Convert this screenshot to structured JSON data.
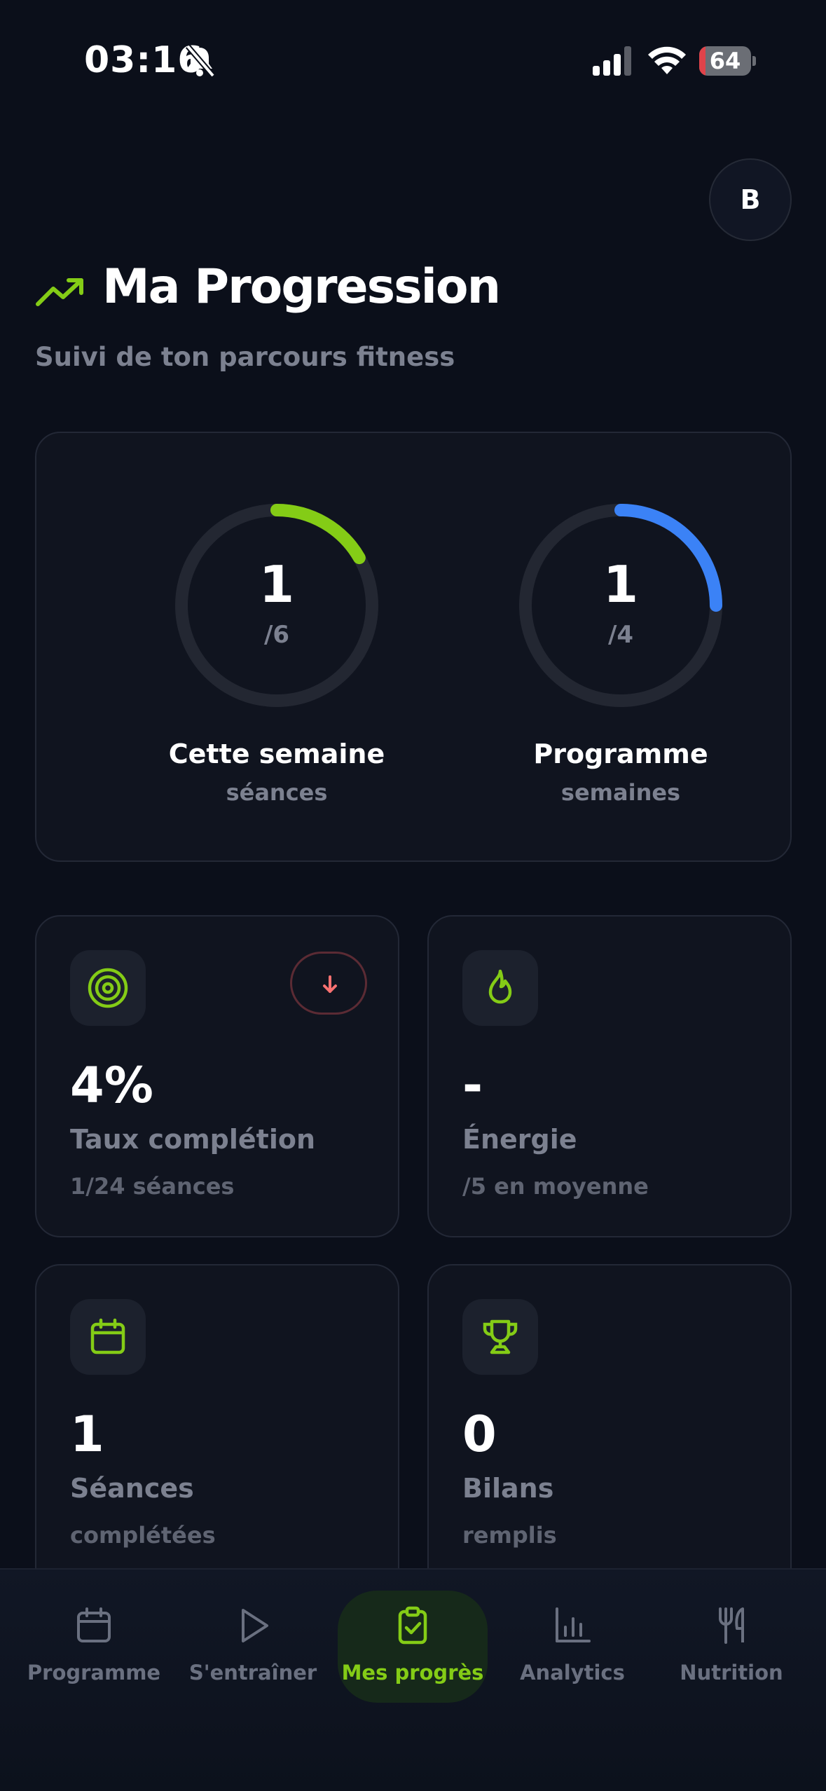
{
  "status_bar": {
    "time": "03:16",
    "battery_level": 64,
    "battery_text": "64",
    "icons": [
      "bell-slash-icon",
      "signal-icon",
      "wifi-icon",
      "battery-charging-icon"
    ]
  },
  "header": {
    "avatar_initial": "B",
    "title": "Ma Progression",
    "subtitle": "Suivi de ton parcours fitness",
    "title_icon": "trending-up-icon"
  },
  "rings": [
    {
      "value": "1",
      "total": "/6",
      "label": "Cette semaine",
      "sublabel": "séances",
      "progress": 0.1667,
      "color": "#84cc16"
    },
    {
      "value": "1",
      "total": "/4",
      "label": "Programme",
      "sublabel": "semaines",
      "progress": 0.25,
      "color": "#3b82f6"
    }
  ],
  "stats": [
    {
      "icon": "target-icon",
      "value": "4%",
      "title": "Taux complétion",
      "sub": "1/24 séances",
      "trend": "down",
      "trend_icon": "arrow-down-icon"
    },
    {
      "icon": "flame-icon",
      "value": "-",
      "title": "Énergie",
      "sub": "/5 en moyenne"
    },
    {
      "icon": "calendar-icon",
      "value": "1",
      "title": "Séances",
      "sub": "complétées"
    },
    {
      "icon": "trophy-icon",
      "value": "0",
      "title": "Bilans",
      "sub": "remplis"
    }
  ],
  "nav": [
    {
      "label": "Programme",
      "icon": "calendar-icon",
      "active": false
    },
    {
      "label": "S'entraîner",
      "icon": "play-icon",
      "active": false
    },
    {
      "label": "Mes progrès",
      "icon": "clipboard-check-icon",
      "active": true
    },
    {
      "label": "Analytics",
      "icon": "bar-chart-icon",
      "active": false
    },
    {
      "label": "Nutrition",
      "icon": "utensils-icon",
      "active": false
    }
  ],
  "colors": {
    "background": "#0b0f1a",
    "card": "#10141f",
    "accent_green": "#84cc16",
    "accent_blue": "#3b82f6",
    "muted_text": "#7c8190",
    "trend_down": "#f87171"
  }
}
